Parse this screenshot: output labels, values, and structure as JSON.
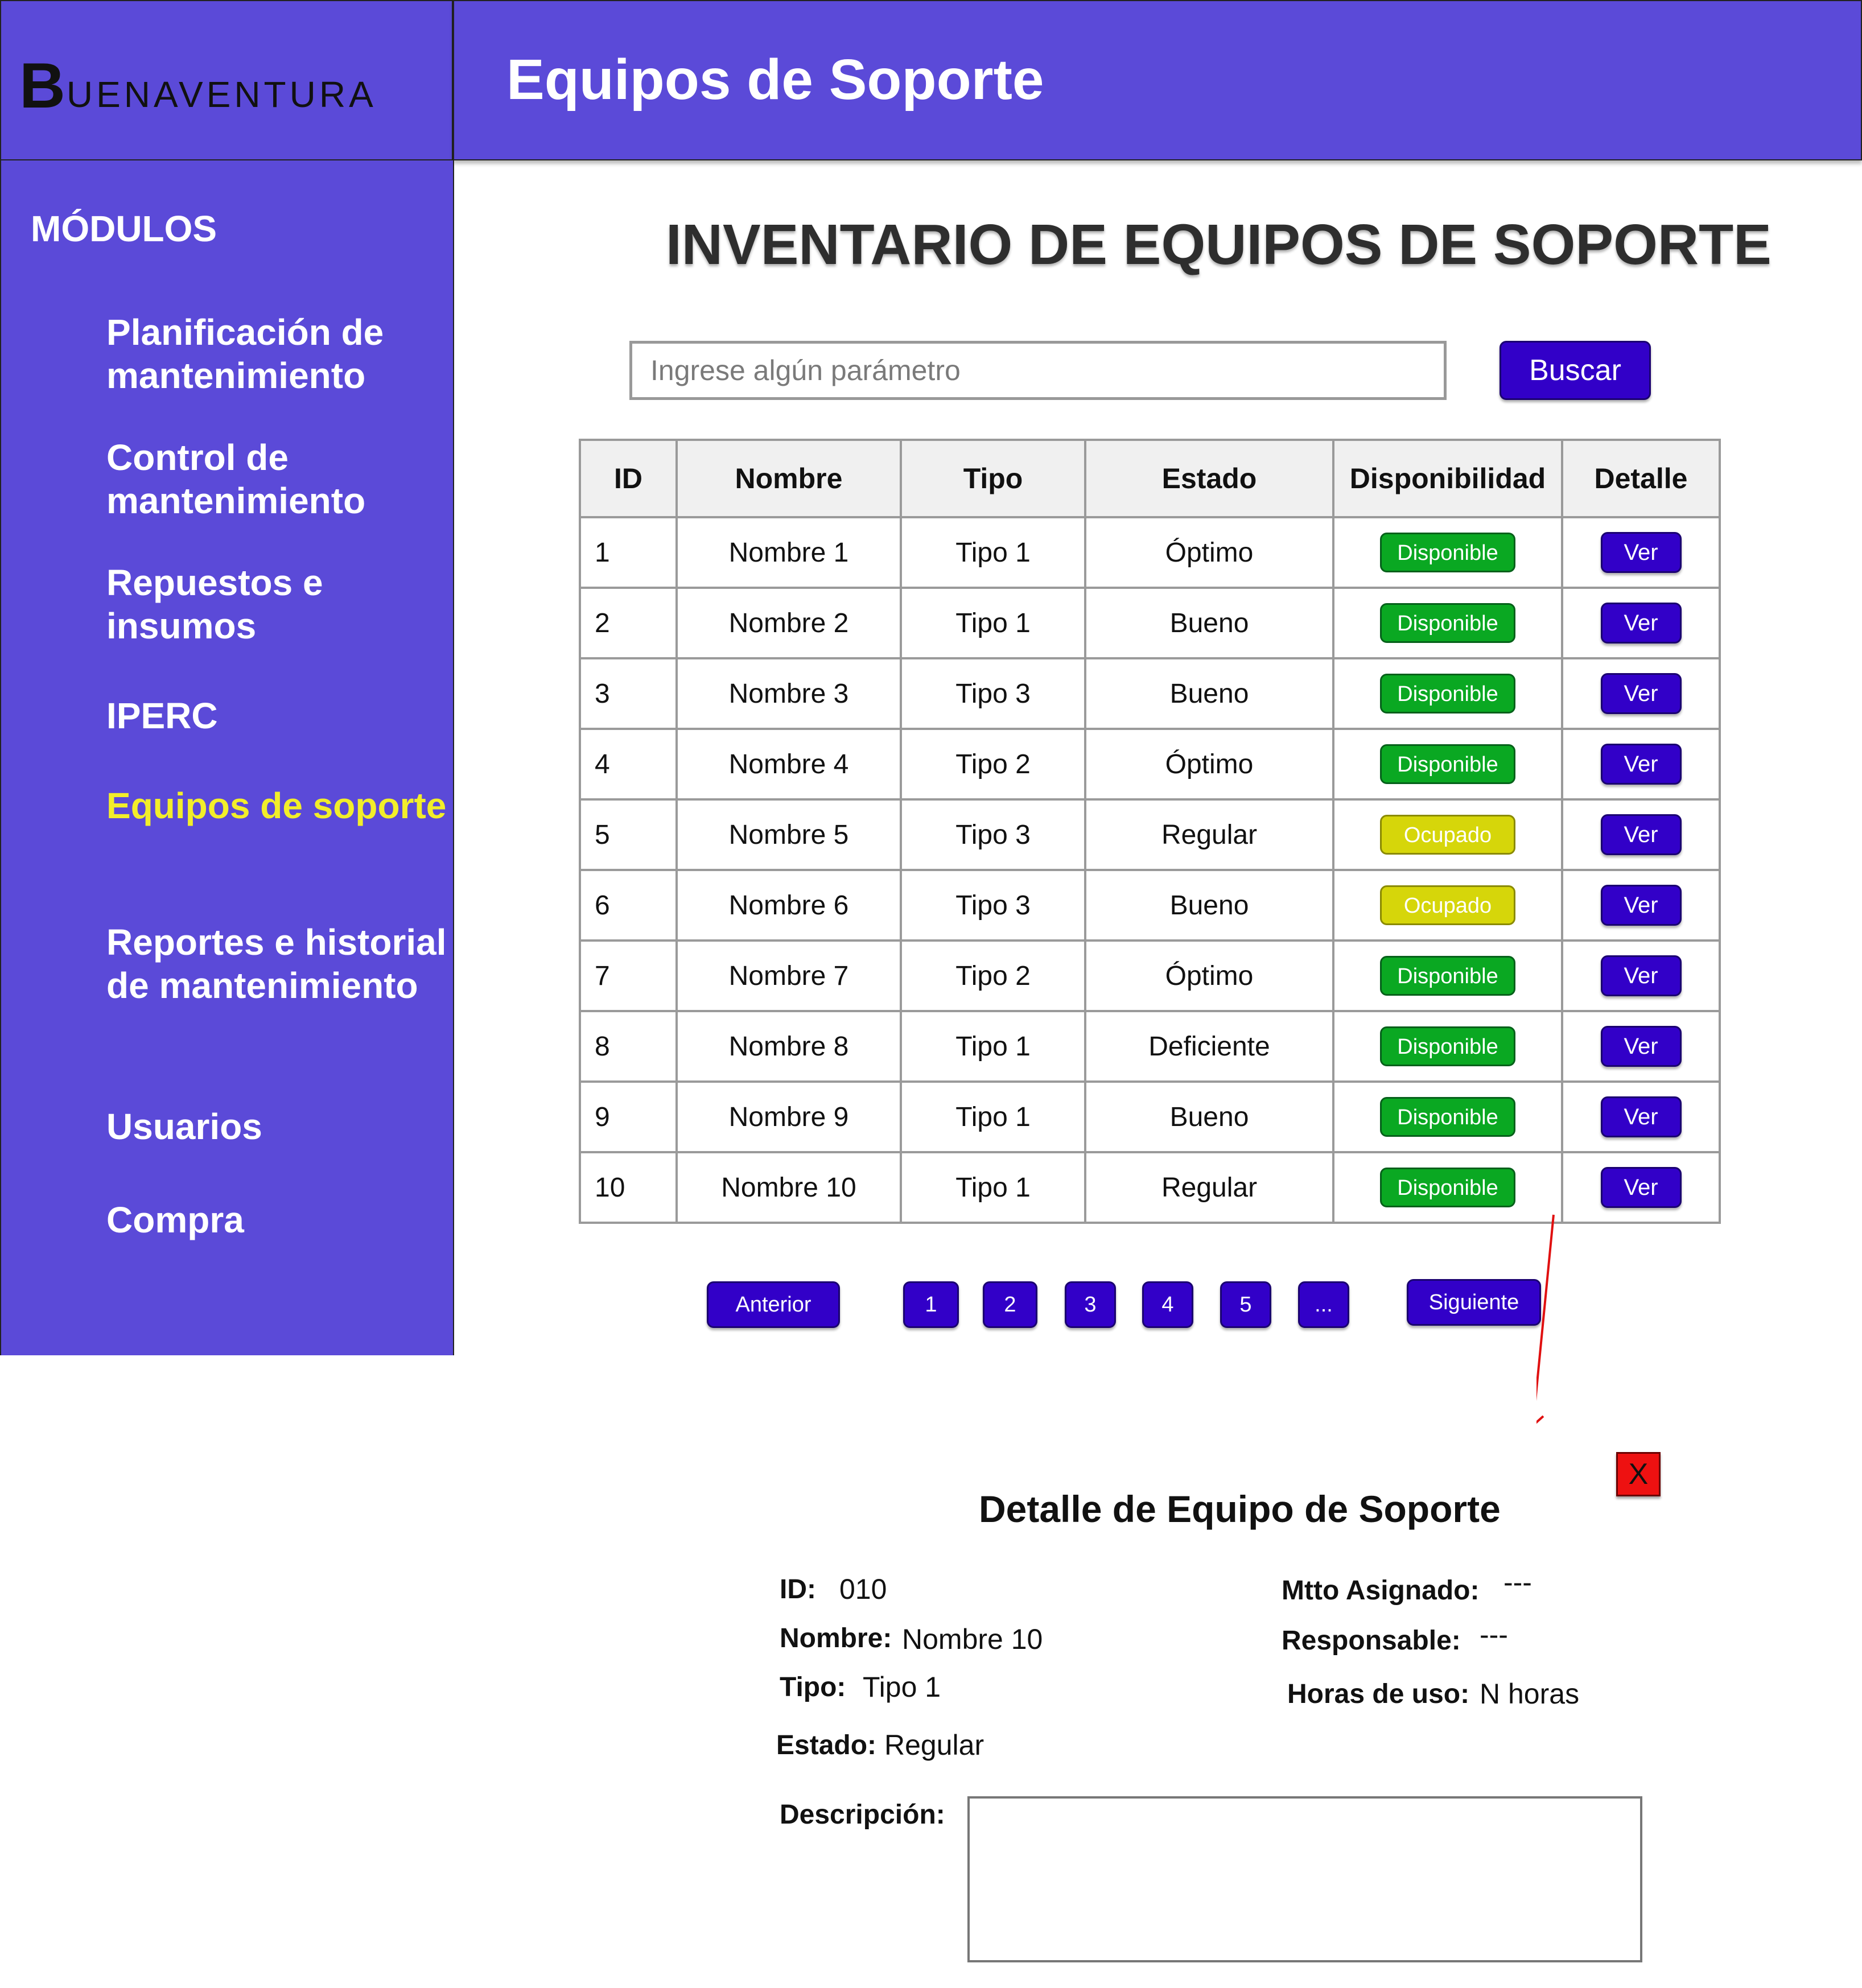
{
  "brand": {
    "logo_initial": "B",
    "logo_rest": "UENAVENTURA"
  },
  "header": {
    "title": "Equipos de Soporte"
  },
  "sidebar": {
    "title": "MÓDULOS",
    "items": [
      {
        "label": "Planificación de mantenimiento",
        "active": false
      },
      {
        "label": "Control de mantenimiento",
        "active": false
      },
      {
        "label": "Repuestos e insumos",
        "active": false
      },
      {
        "label": "IPERC",
        "active": false
      },
      {
        "label": "Equipos de soporte",
        "active": true
      },
      {
        "label": "Reportes e historial de mantenimiento",
        "active": false
      },
      {
        "label": "Usuarios",
        "active": false
      },
      {
        "label": "Compra",
        "active": false
      }
    ]
  },
  "main": {
    "title": "INVENTARIO DE EQUIPOS DE SOPORTE",
    "search": {
      "placeholder": "Ingrese algún parámetro",
      "button_label": "Buscar"
    },
    "table": {
      "headers": [
        "ID",
        "Nombre",
        "Tipo",
        "Estado",
        "Disponibilidad",
        "Detalle"
      ],
      "rows": [
        {
          "id": "1",
          "nombre": "Nombre 1",
          "tipo": "Tipo 1",
          "estado": "Óptimo",
          "disponibilidad": "Disponible",
          "detalle": "Ver"
        },
        {
          "id": "2",
          "nombre": "Nombre 2",
          "tipo": "Tipo 1",
          "estado": "Bueno",
          "disponibilidad": "Disponible",
          "detalle": "Ver"
        },
        {
          "id": "3",
          "nombre": "Nombre 3",
          "tipo": "Tipo 3",
          "estado": "Bueno",
          "disponibilidad": "Disponible",
          "detalle": "Ver"
        },
        {
          "id": "4",
          "nombre": "Nombre 4",
          "tipo": "Tipo 2",
          "estado": "Óptimo",
          "disponibilidad": "Disponible",
          "detalle": "Ver"
        },
        {
          "id": "5",
          "nombre": "Nombre 5",
          "tipo": "Tipo 3",
          "estado": "Regular",
          "disponibilidad": "Ocupado",
          "detalle": "Ver"
        },
        {
          "id": "6",
          "nombre": "Nombre 6",
          "tipo": "Tipo 3",
          "estado": "Bueno",
          "disponibilidad": "Ocupado",
          "detalle": "Ver"
        },
        {
          "id": "7",
          "nombre": "Nombre 7",
          "tipo": "Tipo 2",
          "estado": "Óptimo",
          "disponibilidad": "Disponible",
          "detalle": "Ver"
        },
        {
          "id": "8",
          "nombre": "Nombre 8",
          "tipo": "Tipo 1",
          "estado": "Deficiente",
          "disponibilidad": "Disponible",
          "detalle": "Ver"
        },
        {
          "id": "9",
          "nombre": "Nombre 9",
          "tipo": "Tipo 1",
          "estado": "Bueno",
          "disponibilidad": "Disponible",
          "detalle": "Ver"
        },
        {
          "id": "10",
          "nombre": "Nombre 10",
          "tipo": "Tipo 1",
          "estado": "Regular",
          "disponibilidad": "Disponible",
          "detalle": "Ver"
        }
      ]
    },
    "pagination": {
      "prev_label": "Anterior",
      "pages": [
        "1",
        "2",
        "3",
        "4",
        "5",
        "..."
      ],
      "next_label": "Siguiente"
    }
  },
  "detail": {
    "close_label": "X",
    "title": "Detalle de Equipo de Soporte",
    "id_label": "ID:",
    "id_value": "010",
    "nombre_label": "Nombre:",
    "nombre_value": "Nombre 10",
    "tipo_label": "Tipo:",
    "tipo_value": "Tipo 1",
    "estado_label": "Estado:",
    "estado_value": "Regular",
    "mtto_label": "Mtto Asignado:",
    "mtto_value": "---",
    "responsable_label": "Responsable:",
    "responsable_value": "---",
    "horas_label": "Horas de uso:",
    "horas_value": "N horas",
    "descripcion_label": "Descripción:",
    "descripcion_value": ""
  },
  "colors": {
    "primary_purple": "#5b4ad8",
    "button_dark": "#3200c8",
    "active_nav": "#f2ee2a",
    "available_green": "#0aa822",
    "busy_yellow": "#d6d60a",
    "close_red": "#ee1111",
    "arrow_red": "#e01010"
  }
}
